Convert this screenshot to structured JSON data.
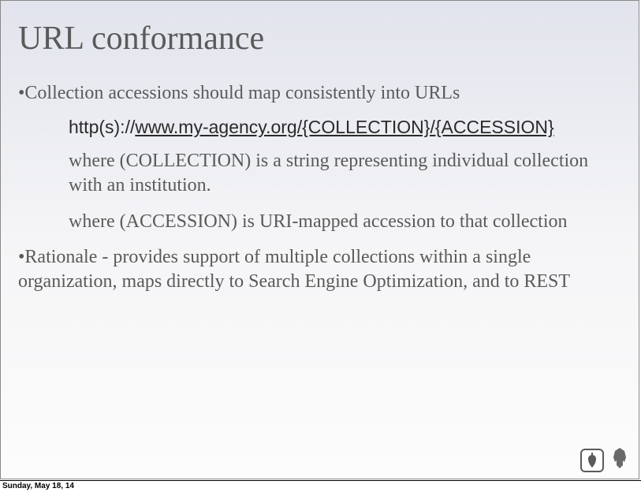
{
  "title": "URL conformance",
  "bullets": {
    "b1": "Collection accessions should map consistently into URLs",
    "url_prefix": "http(s)://",
    "url_main": "www.my-agency.org/{COLLECTION}/{ACCESSION}",
    "sub1": "where (COLLECTION) is a string representing individual collection with an institution.",
    "sub2": "where (ACCESSION) is URI-mapped accession to that collection",
    "b2": "Rationale - provides support of multiple collections within a single organization, maps directly to Search Engine Optimization, and to REST"
  },
  "footer": {
    "date": "Sunday, May 18, 14"
  }
}
